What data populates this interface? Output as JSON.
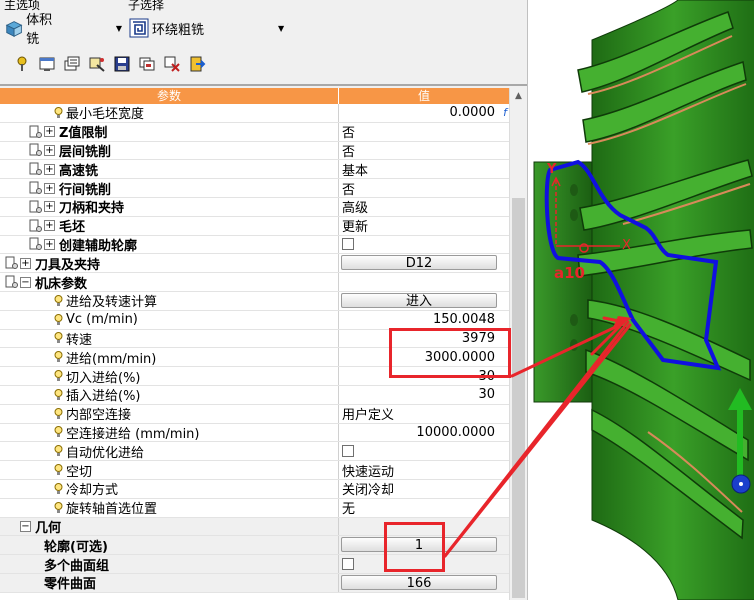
{
  "header": {
    "main_option_label": "主选项",
    "main_option_value": "体积铣",
    "sub_option_label": "子选择",
    "sub_option_value": "环绕粗铣"
  },
  "toolbar": {
    "icons": [
      "pin-icon",
      "window-icon",
      "list-icon",
      "tool-icon",
      "save-icon",
      "layers-icon",
      "properties-icon",
      "exit-icon"
    ]
  },
  "grid": {
    "col_param": "参数",
    "col_value": "值",
    "rows": [
      {
        "label": "最小毛坯宽度",
        "value": "0.0000",
        "fx": "f"
      },
      {
        "label": "Z值限制",
        "value": "否"
      },
      {
        "label": "层间铣削",
        "value": "否"
      },
      {
        "label": "高速铣",
        "value": "基本"
      },
      {
        "label": "行间铣削",
        "value": "否"
      },
      {
        "label": "刀柄和夹持",
        "value": "高级"
      },
      {
        "label": "毛坯",
        "value": "更新"
      },
      {
        "label": "创建辅助轮廓",
        "value": ""
      },
      {
        "label": "刀具及夹持",
        "value": "D12"
      },
      {
        "label": "机床参数",
        "value": ""
      },
      {
        "label": "进给及转速计算",
        "value": "进入"
      },
      {
        "label": "Vc (m/min)",
        "value": "150.0048"
      },
      {
        "label": "转速",
        "value": "3979"
      },
      {
        "label": "进给(mm/min)",
        "value": "3000.0000"
      },
      {
        "label": "切入进给(%)",
        "value": "30"
      },
      {
        "label": "插入进给(%)",
        "value": "30"
      },
      {
        "label": "内部空连接",
        "value": "用户定义"
      },
      {
        "label": "空连接进给 (mm/min)",
        "value": "10000.0000"
      },
      {
        "label": "自动优化进给",
        "value": ""
      },
      {
        "label": "空切",
        "value": "快速运动"
      },
      {
        "label": "冷却方式",
        "value": "关闭冷却"
      },
      {
        "label": "旋转轴首选位置",
        "value": "无"
      },
      {
        "label": "几何",
        "value": ""
      },
      {
        "label": "轮廓(可选)",
        "value": "1"
      },
      {
        "label": "多个曲面组",
        "value": ""
      },
      {
        "label": "零件曲面",
        "value": "166"
      }
    ]
  },
  "view": {
    "axis_y": "Y",
    "axis_x": "X",
    "annotation": "a10",
    "colors": {
      "part_green": "#2e8b1e",
      "contour_blue": "#1010e0",
      "annotation_red": "#e8252b",
      "arrow_green": "#22bb22"
    }
  }
}
